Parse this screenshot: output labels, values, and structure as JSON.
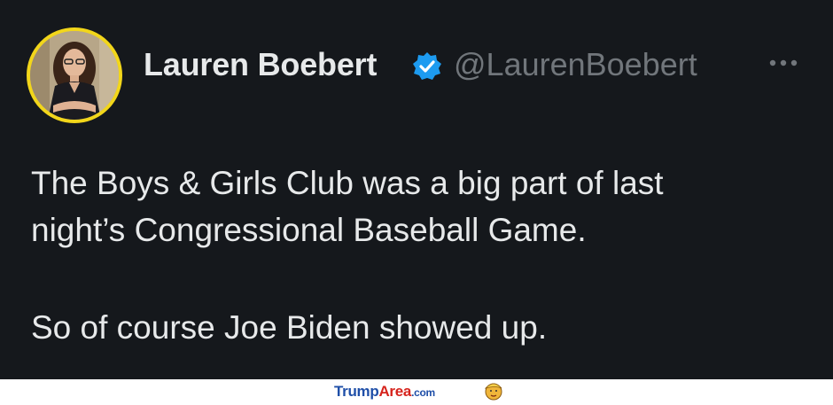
{
  "tweet": {
    "author_name": "Lauren Boebert",
    "handle": "@LaurenBoebert",
    "more_icon": "more-horizontal-icon",
    "verified_icon": "verified-badge-icon",
    "text_lines": [
      "The Boys & Girls Club was a big part of last",
      "night’s Congressional Baseball Game.",
      "So of course Joe Biden showed up."
    ]
  },
  "footer": {
    "brand_part1": "Trump",
    "brand_part2": "Area",
    "brand_suffix": ".com"
  },
  "colors": {
    "background": "#15181c",
    "text": "#e7e9ea",
    "muted": "#71767b",
    "verified": "#1d9bf0",
    "avatar_border": "#f2d61a"
  }
}
